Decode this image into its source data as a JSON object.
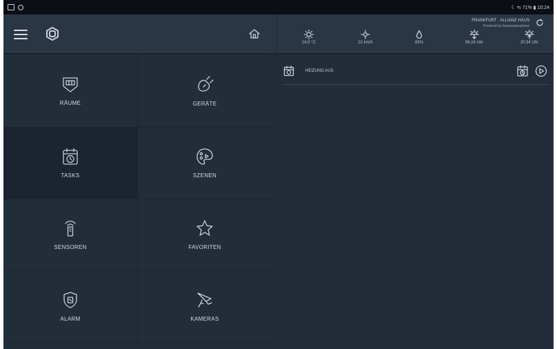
{
  "statusbar": {
    "right_text": "☾ ⇆ 71% ▮ 10:24"
  },
  "header": {
    "location": "FRANKFURT · ALLIANZ HAUS",
    "location_sub": "Powered by Gatewaybusiness"
  },
  "weather": [
    {
      "icon": "sun-icon",
      "value": "14,0 °C"
    },
    {
      "icon": "brightness-icon",
      "value": "22 km/h"
    },
    {
      "icon": "raindrop-icon",
      "value": "85%"
    },
    {
      "icon": "sunrise-icon",
      "value": "06:24 Uhr"
    },
    {
      "icon": "sunset-icon",
      "value": "20:34 Uhr"
    }
  ],
  "tiles": [
    {
      "name": "raeume",
      "label": "RÄUME"
    },
    {
      "name": "geraete",
      "label": "GERÄTE"
    },
    {
      "name": "tasks",
      "label": "TASKS"
    },
    {
      "name": "szenen",
      "label": "SZENEN"
    },
    {
      "name": "sensoren",
      "label": "SENSOREN"
    },
    {
      "name": "favoriten",
      "label": "FAVORITEN"
    },
    {
      "name": "alarm",
      "label": "ALARM"
    },
    {
      "name": "kameras",
      "label": "KAMERAS"
    }
  ],
  "tasks": [
    {
      "name": "HEIZUNG AUS"
    }
  ],
  "colors": {
    "background": "#232d3a",
    "header": "#2b3645",
    "active_tile": "#1b2430",
    "text": "#c9d1dc"
  }
}
